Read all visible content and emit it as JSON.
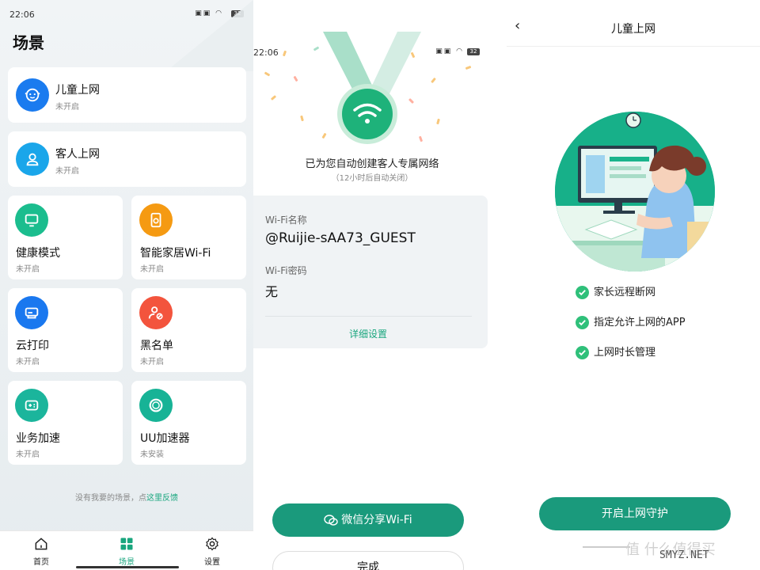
{
  "status": {
    "time": "22:06",
    "battery": "32"
  },
  "scenes": {
    "title": "场景",
    "items": [
      {
        "label": "儿童上网",
        "status": "未开启",
        "icon": "child-face-icon",
        "color": "#1a7bef"
      },
      {
        "label": "客人上网",
        "status": "未开启",
        "icon": "guest-user-icon",
        "color": "#1aa6ea"
      },
      {
        "label": "健康模式",
        "status": "未开启",
        "icon": "monitor-icon",
        "color": "#1bbd8e"
      },
      {
        "label": "智能家居Wi-Fi",
        "status": "未开启",
        "icon": "smart-home-icon",
        "color": "#f59a12"
      },
      {
        "label": "云打印",
        "status": "未开启",
        "icon": "printer-icon",
        "color": "#1a78ef"
      },
      {
        "label": "黑名单",
        "status": "未开启",
        "icon": "blocked-user-icon",
        "color": "#f3543d"
      },
      {
        "label": "业务加速",
        "status": "未开启",
        "icon": "gamepad-icon",
        "color": "#1bb59c"
      },
      {
        "label": "UU加速器",
        "status": "未安装",
        "icon": "uu-accelerator-icon",
        "color": "#17b396"
      }
    ],
    "feedback_text": "没有我要的场景，点",
    "feedback_link": "这里反馈",
    "tabs": [
      {
        "label": "首页",
        "icon": "home-icon"
      },
      {
        "label": "场景",
        "icon": "grid-icon"
      },
      {
        "label": "设置",
        "icon": "gear-icon"
      }
    ]
  },
  "guest": {
    "headline": "已为您自动创建客人专属网络",
    "subline": "（12小时后自动关闭）",
    "wifi_name_label": "Wi-Fi名称",
    "wifi_name": "@Ruijie-sAA73_GUEST",
    "wifi_password_label": "Wi-Fi密码",
    "wifi_password": "无",
    "detail_link": "详细设置",
    "share_button": "微信分享Wi-Fi",
    "done_button": "完成"
  },
  "child": {
    "title": "儿童上网",
    "features": [
      "家长远程断网",
      "指定允许上网的APP",
      "上网时长管理"
    ],
    "enable_button": "开启上网守护",
    "watermark_text": "值 什么值得买",
    "watermark_site": "SMYZ.NET"
  },
  "colors": {
    "accent": "#1a9a7c",
    "link": "#19a67e",
    "check": "#2fc07a"
  }
}
